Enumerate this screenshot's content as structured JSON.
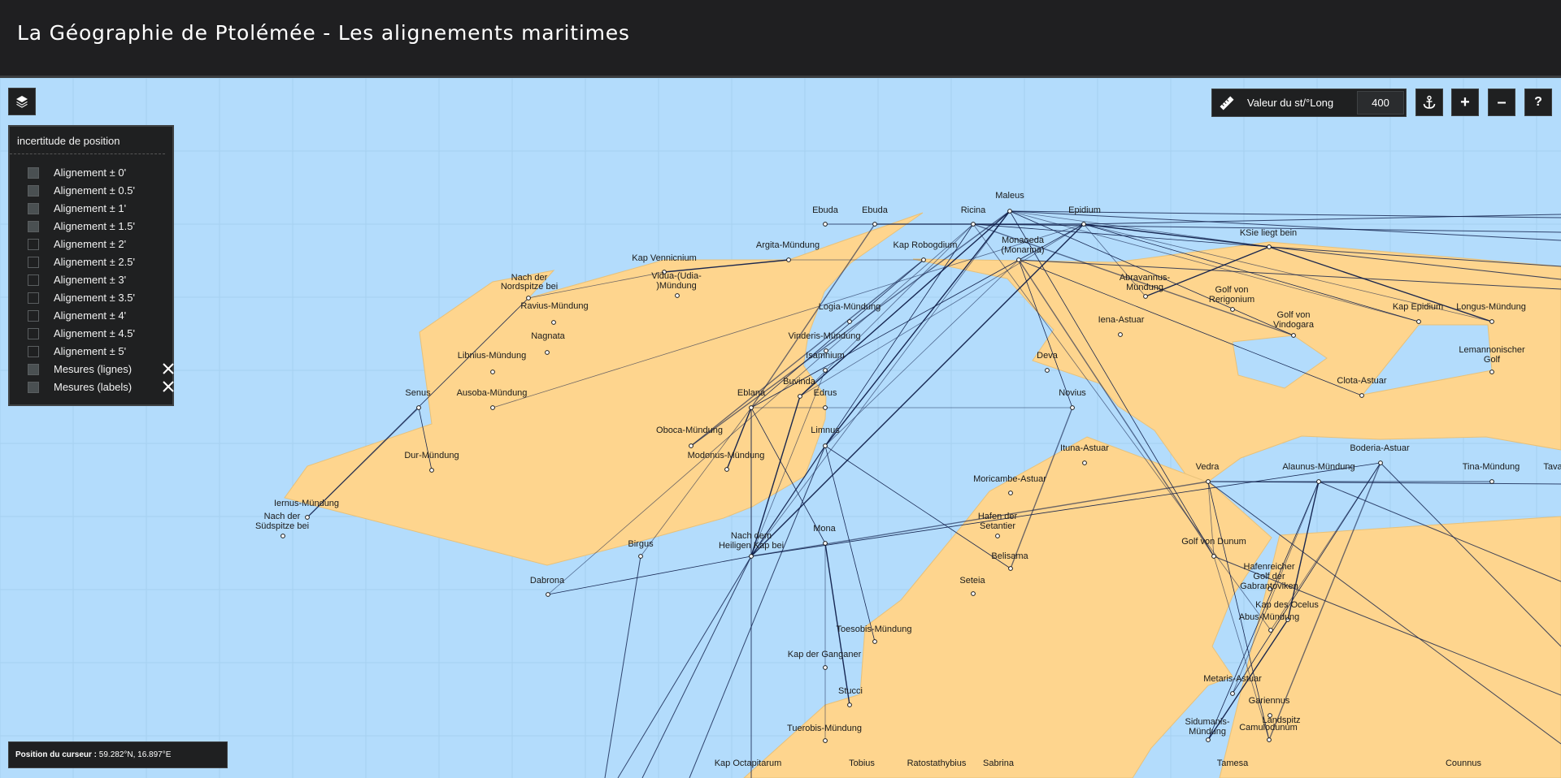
{
  "header": {
    "title": "La Géographie de Ptolémée - Les alignements maritimes"
  },
  "toolbar": {
    "ruler_icon": "ruler-icon",
    "measure_label": "Valeur du st/°Long",
    "measure_value": "400",
    "anchor_icon": "anchor-icon",
    "zoom_in_label": "+",
    "zoom_out_label": "–",
    "help_label": "?",
    "layers_icon": "layers-icon"
  },
  "legend": {
    "title": "incertitude de position",
    "items": [
      {
        "label": "Alignement ± 0'",
        "checked": true
      },
      {
        "label": "Alignement ± 0.5'",
        "checked": true
      },
      {
        "label": "Alignement ± 1'",
        "checked": true
      },
      {
        "label": "Alignement ± 1.5'",
        "checked": true
      },
      {
        "label": "Alignement ± 2'",
        "checked": false
      },
      {
        "label": "Alignement ± 2.5'",
        "checked": false
      },
      {
        "label": "Alignement ± 3'",
        "checked": false
      },
      {
        "label": "Alignement ± 3.5'",
        "checked": false
      },
      {
        "label": "Alignement ± 4'",
        "checked": false
      },
      {
        "label": "Alignement ± 4.5'",
        "checked": false
      },
      {
        "label": "Alignement ± 5'",
        "checked": false
      },
      {
        "label": "Mesures (lignes)",
        "checked": true,
        "clearable": true
      },
      {
        "label": "Mesures (labels)",
        "checked": true,
        "clearable": true
      }
    ]
  },
  "status": {
    "label": "Position du curseur :",
    "value": "59.282°N, 16.897°E"
  },
  "map": {
    "colors": {
      "sea": "#b3dcfc",
      "land": "#fed58e",
      "line": "#0f1e4a"
    },
    "places": [
      "Ebuda",
      "Ebuda",
      "Ricina",
      "Maleus",
      "Epidium",
      "KSie liegt bein",
      "Argita-Mündung",
      "Kap Robogdium",
      "Monaoeda",
      "(Monarina)",
      "Kap Vennicnium",
      "Vidua-(Udia-",
      ")Mündung",
      "Nach der",
      "Nordspitze bei",
      "Ravius-Mündung",
      "Abravannus-",
      "Mündung",
      "Golf von",
      "Rerigonium",
      "Golf von",
      "Vindogara",
      "Kap Epidium",
      "Longus-Mündung",
      "Logia-Mündung",
      "Iena-Astuar",
      "Lemannonischer",
      "Golf",
      "Nagnata",
      "Vinderis-Mündung",
      "Isamnium",
      "Libnius-Mündung",
      "Deva",
      "Clota-Astuar",
      "Buvinda",
      "Senus",
      "Ausoba-Mündung",
      "Eblana",
      "Edrus",
      "Novius",
      "Oboca-Mündung",
      "Limnus",
      "Ituna-Astuar",
      "Boderia-Astuar",
      "Dur-Mündung",
      "Modonus-Mündung",
      "Vedra",
      "Alaunus-Mündung",
      "Tina-Mündung",
      "Tava",
      "Moricambe-Astuar",
      "Iernus-Mündung",
      "Nach der",
      "Südspitze bei",
      "Hafen der",
      "Setantier",
      "Birgus",
      "Nach dem",
      "Heiligen Kap bei",
      "Mona",
      "Golf von Dunum",
      "Belisama",
      "Hafenreicher",
      "Golf der",
      "Gabrantoviken",
      "Dabrona",
      "Seteia",
      "Kap des Ocelus",
      "Abus-Mündung",
      "Toesobis-Mündung",
      "Kap der Ganganer",
      "Metaris-Astuar",
      "Stucci",
      "Gariennus",
      "Sidumanis-",
      "Mündung",
      "Landspitz",
      "Camulodunum",
      "Tuerobis-Mündung",
      "Kap Octapitarum",
      "Tobius",
      "Ratostathybius",
      "Sabrina",
      "Tamesa",
      "Counnus"
    ]
  }
}
